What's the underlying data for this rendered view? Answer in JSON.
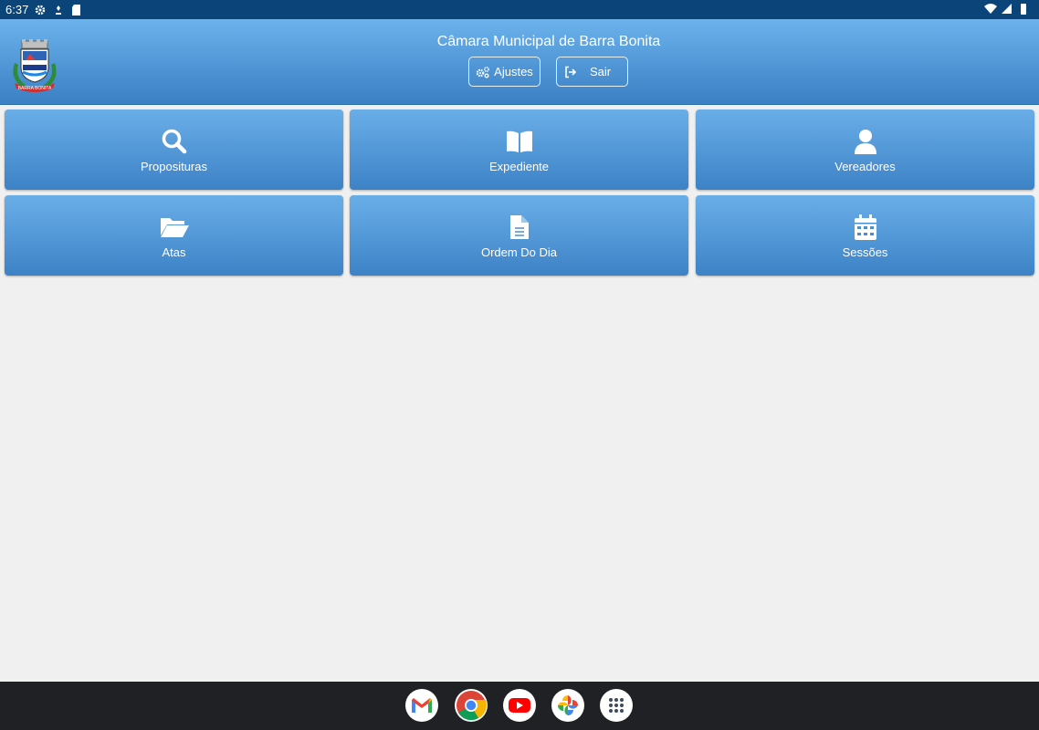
{
  "status_bar": {
    "time": "6:37"
  },
  "header": {
    "title": "Câmara Municipal de Barra Bonita",
    "settings_label": "Ajustes",
    "logout_label": "Sair"
  },
  "tiles": [
    {
      "label": "Proposituras",
      "icon": "search-icon"
    },
    {
      "label": "Expediente",
      "icon": "open-book-icon"
    },
    {
      "label": "Vereadores",
      "icon": "user-icon"
    },
    {
      "label": "Atas",
      "icon": "folder-open-icon"
    },
    {
      "label": "Ordem Do Dia",
      "icon": "document-icon"
    },
    {
      "label": "Sessões",
      "icon": "calendar-icon"
    }
  ],
  "dock": {
    "apps": [
      "gmail-icon",
      "chrome-icon",
      "youtube-icon",
      "photos-icon",
      "app-drawer-icon"
    ]
  },
  "colors": {
    "header_top": "#6cb2ec",
    "header_bottom": "#3a80c4",
    "status_bar": "#0b4478",
    "background": "#f0f0f0"
  }
}
